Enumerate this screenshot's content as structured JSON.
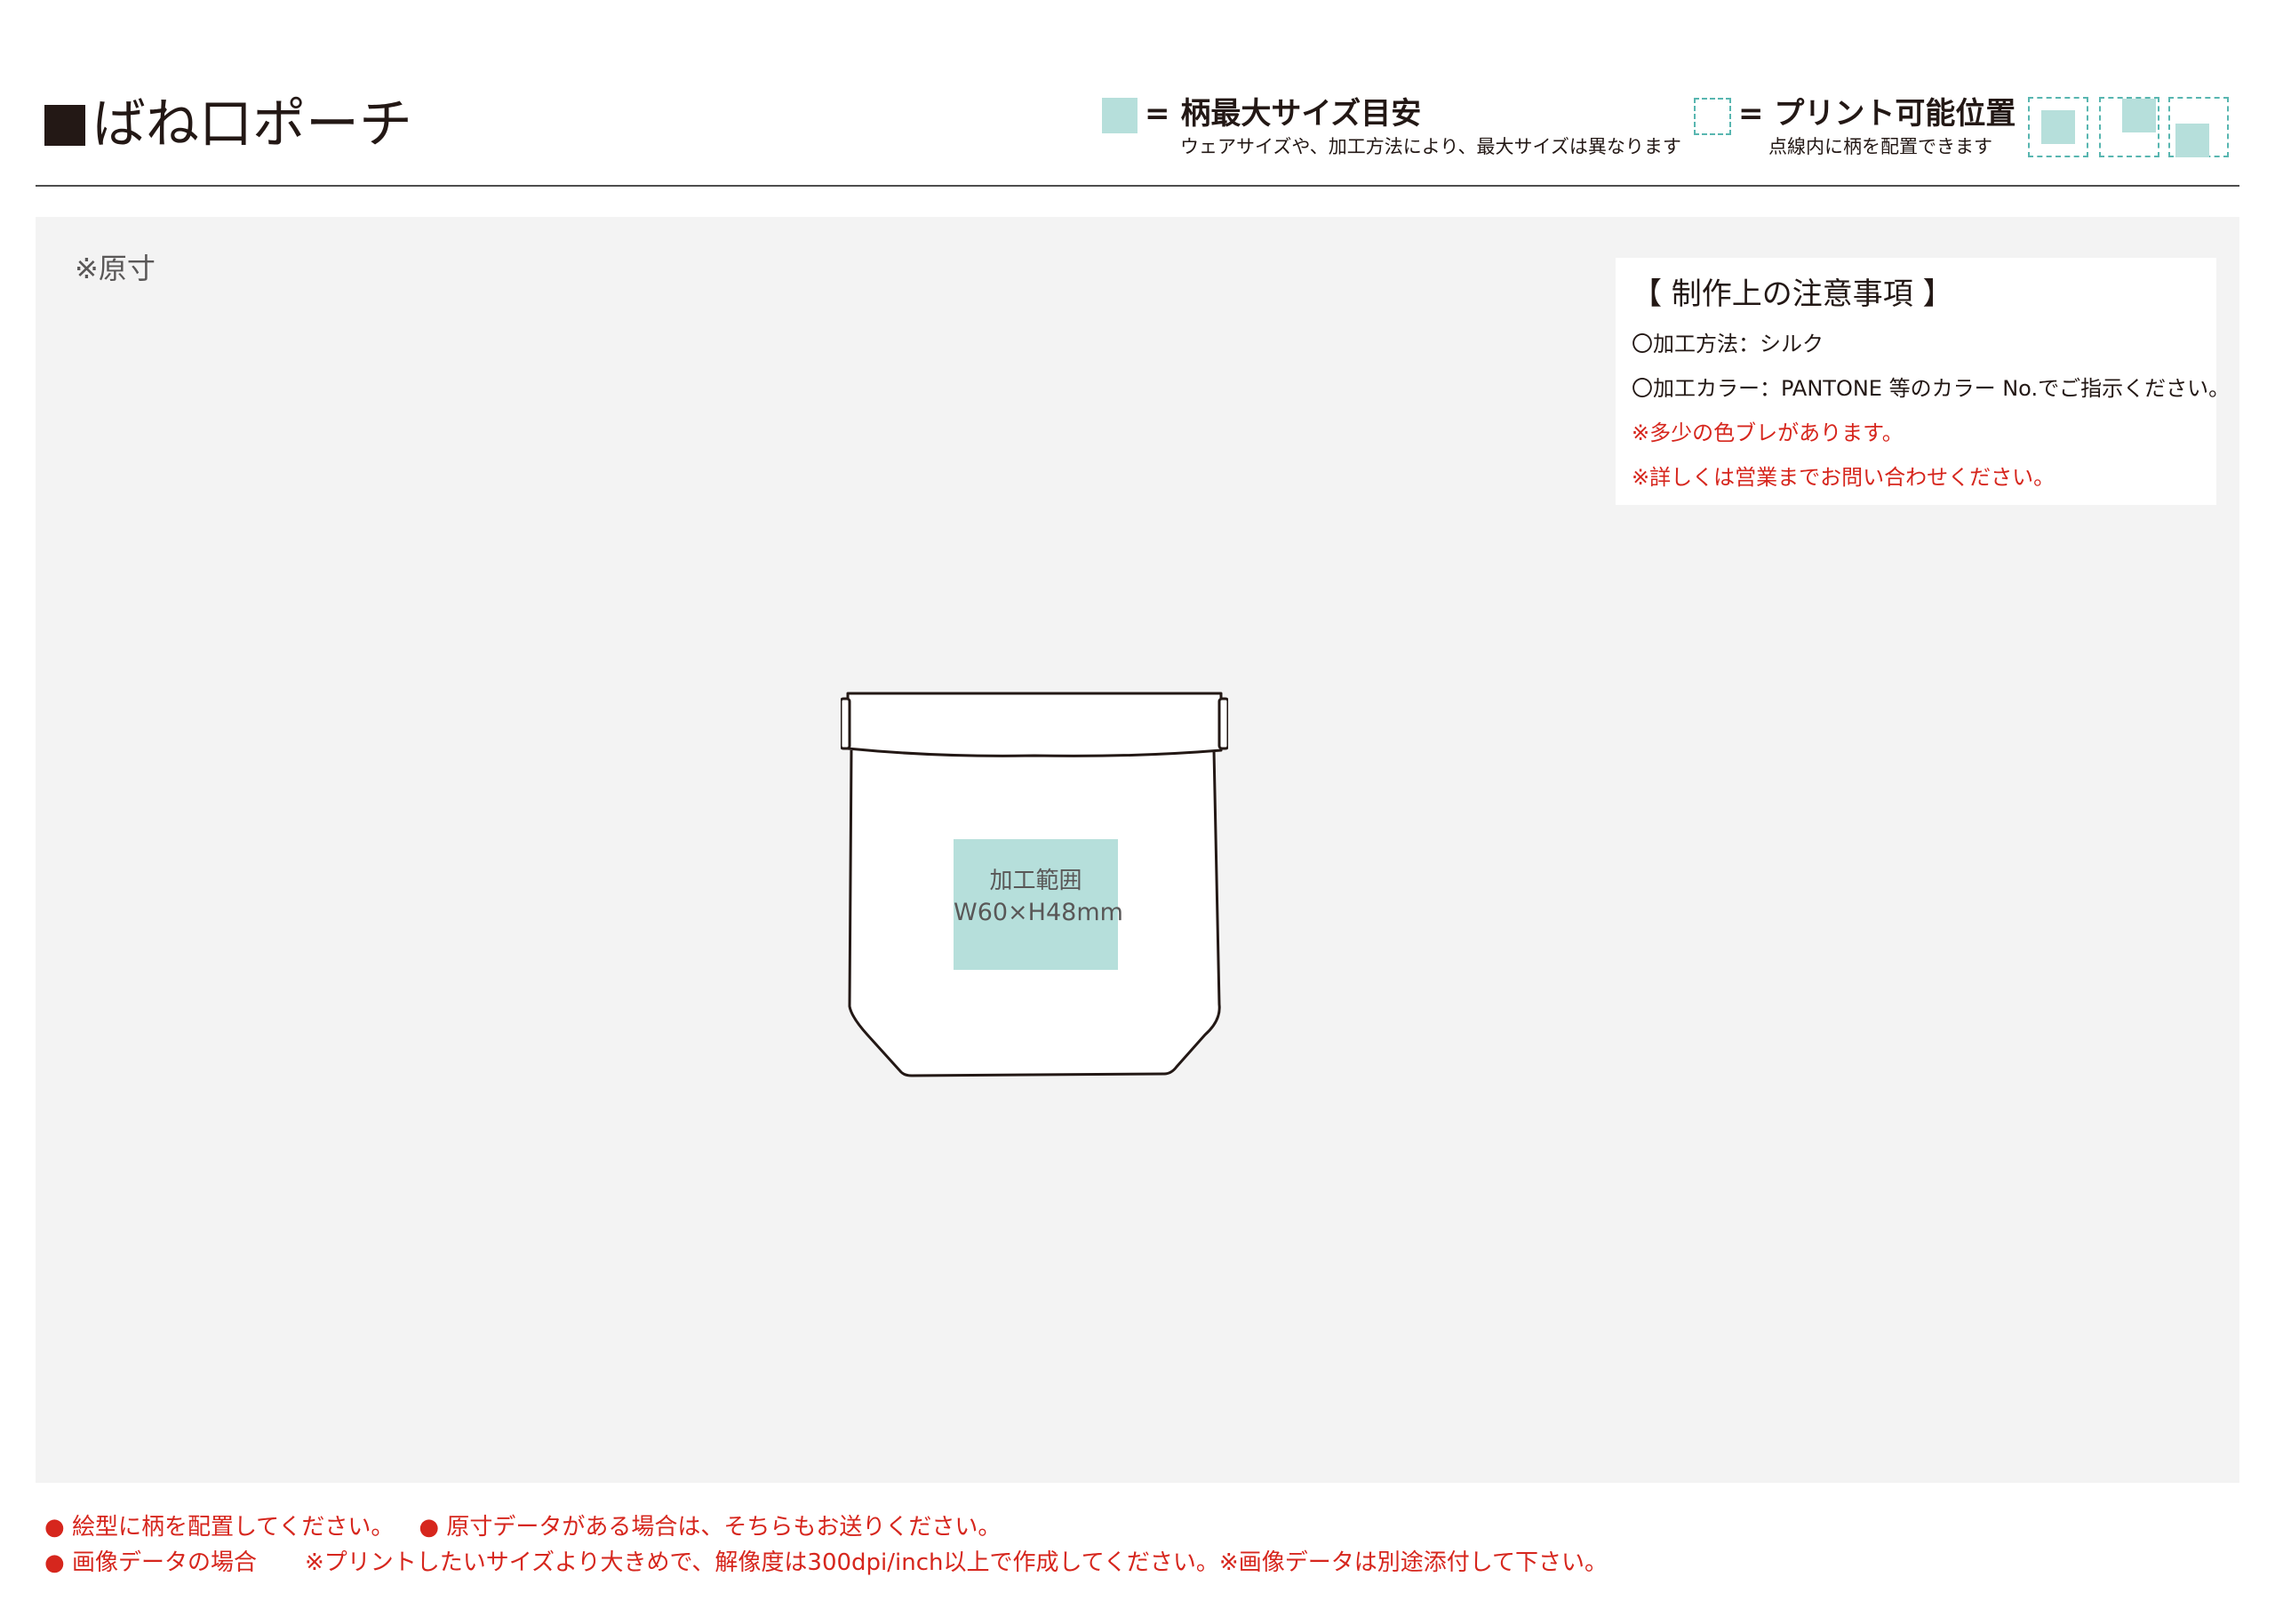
{
  "header": {
    "title": "ばね口ポーチ",
    "legend_max_size": {
      "label": "= 柄最大サイズ目安",
      "note": "ウェアサイズや、加工方法により、最大サイズは異なります",
      "swatch_color": "#b6dfdb"
    },
    "legend_print_position": {
      "label": "= プリント可能位置",
      "note": "点線内に柄を配置できます",
      "border_color": "#58b6b0"
    }
  },
  "panel": {
    "scale_note": "※原寸",
    "notes": {
      "title": "【 制作上の注意事項 】",
      "items": [
        "〇加工方法：シルク",
        "〇加工カラー：PANTONE 等のカラー No.でご指示ください。",
        "※多少の色ブレがあります。",
        "※詳しくは営業までお問い合わせください。"
      ],
      "warning_color": "#d6261d"
    },
    "print_area": {
      "label": "加工範囲",
      "size": "W60×H48mm"
    }
  },
  "footer": {
    "line1": [
      "● 絵型に柄を配置してください。",
      "● 原寸データがある場合は、そちらもお送りください。"
    ],
    "line2": [
      "● 画像データの場合",
      "※プリントしたいサイズより大きめで、解像度は300dpi/inch以上で作成してください。※画像データは別途添付して下さい。"
    ],
    "color": "#d6261d"
  }
}
